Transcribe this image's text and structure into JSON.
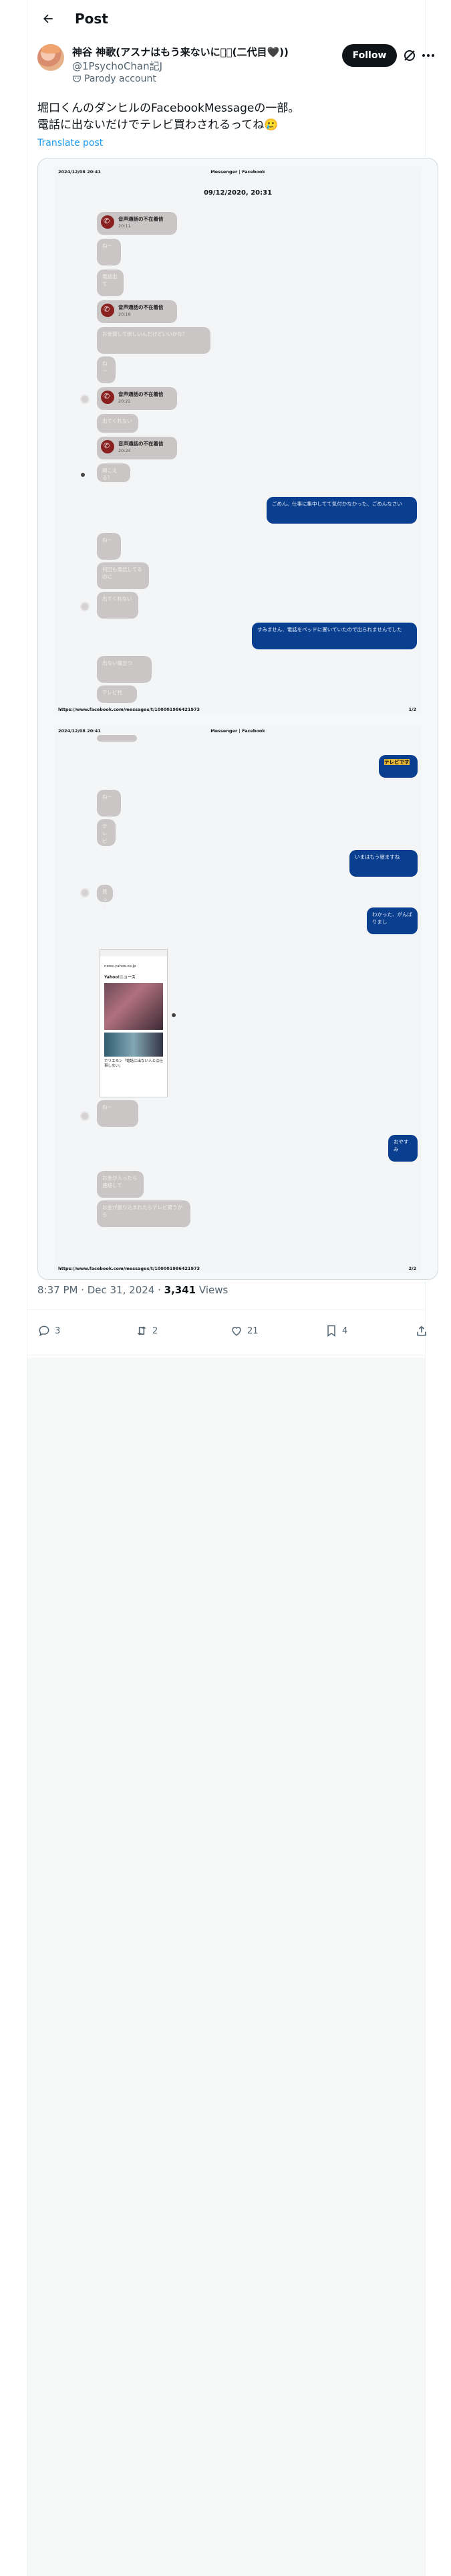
{
  "header": {
    "title": "Post"
  },
  "author": {
    "display_name": "神谷 神歌(アスナはもう来ないにょ🏽(二代目🖤))",
    "handle": "@1PsychoChan記J",
    "badge_label": "Parody account",
    "follow_label": "Follow"
  },
  "post": {
    "lines": [
      "堀口くんのダンヒルのFacebookMessageの一部。",
      "電話に出ないだけでテレビ買わされるってね🥲"
    ],
    "translate_label": "Translate post"
  },
  "screenshot": {
    "page1": {
      "header_left": "2024/12/08 20:41",
      "header_center": "Messenger | Facebook",
      "date": "09/12/2020, 20:31",
      "footer_left": "https://www.facebook.com/messages/t/100001986421973",
      "footer_right": "1/2",
      "call_title": "音声通話の不在着信",
      "call_times": [
        "20:11",
        "20:16",
        "20:22",
        "20:24"
      ],
      "in_messages": [
        "ねー",
        "電話出て",
        "お金貸して欲しいんだけどいいかな？",
        "ねー",
        "出てくれない",
        "聞こえる？",
        "ねー",
        "何回も電話してるのに",
        "出てくれない",
        "出ない腹立つ",
        "テレビ代"
      ],
      "out_messages": [
        "ごめん、仕事に集中してて気付かなかった、ごめんなさい",
        "すみません、電話をベッドに置いていたので出られませんでした"
      ]
    },
    "page2": {
      "header_left": "2024/12/08 20:41",
      "header_center": "Messenger | Facebook",
      "footer_left": "https://www.facebook.com/messages/t/100001986421973",
      "footer_right": "2/2",
      "highlight_message": "テレビです",
      "in_messages": [
        "ねー",
        "テレビ",
        "買って",
        "ねー",
        "お金が入ったら連絡して",
        "テレビ",
        "買ってくれたら許す",
        "お金が振り込まれたらテレビ買うから"
      ],
      "out_messages": [
        "いまはもう寝ますね",
        "わかった、がんばりまし",
        "おやすみ"
      ],
      "shared_link": {
        "url": "news.yahoo.co.jp",
        "title": "Yahoo!ニュース",
        "caption": "ホリエモン「電話に出ない人とは仕事しない」"
      }
    }
  },
  "meta": {
    "time": "8:37 PM · Dec 31, 2024",
    "views": "3,341",
    "views_label": "Views"
  },
  "actions": {
    "replies": "3",
    "reposts": "2",
    "likes": "21",
    "bookmarks": "4"
  }
}
